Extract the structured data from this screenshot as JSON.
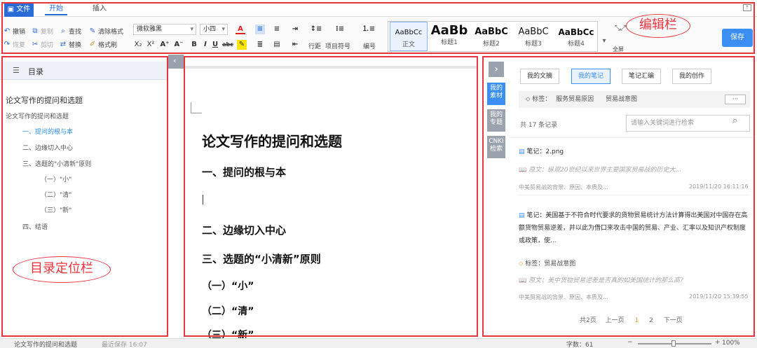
{
  "tabs": {
    "file": "文件",
    "home": "开始",
    "insert": "插入"
  },
  "toolbar": {
    "undo": "撤销",
    "redo": "恢复",
    "copy": "复制",
    "cut": "剪切",
    "find": "查找",
    "replace": "替换",
    "clear_format": "清除格式",
    "format_painter": "格式刷",
    "font_name": "微软雅黑",
    "font_size": "小四",
    "line_spacing": "行距",
    "list_symbol": "项目符号",
    "numbering": "编号",
    "select_all": "全屏",
    "save": "保存"
  },
  "styles": [
    {
      "preview": "AaBbCc",
      "name": "正文"
    },
    {
      "preview": "AaBb",
      "name": "标题1"
    },
    {
      "preview": "AaBbC",
      "name": "标题2"
    },
    {
      "preview": "AaBbC",
      "name": "标题3"
    },
    {
      "preview": "AaBbCc",
      "name": "标题4"
    }
  ],
  "annotations": {
    "editor_bar": "编辑栏",
    "toc_bar": "目录定位栏"
  },
  "toc": {
    "title": "目录",
    "items": [
      "论文写作的提问和选题",
      "论文写作的提问和选题",
      "一、提问的根与本",
      "二、边缘切入中心",
      "三、选题的\"小清新\"原则",
      "（一）\"小\"",
      "（二）\"清\"",
      "（三）\"新\"",
      "四、结语"
    ]
  },
  "editor": {
    "title": "论文写作的提问和选题",
    "lines": [
      "一、提问的根与本",
      "二、边缘切入中心",
      "三、选题的“小清新”原则",
      "（一）“小”",
      "（二）“清”",
      "（三）“新”"
    ]
  },
  "side_tabs": [
    {
      "label": "我的\n素材"
    },
    {
      "label": "我的\n专题"
    },
    {
      "label": "CNKI\n检索"
    }
  ],
  "right": {
    "tabs": [
      "我的文摘",
      "我的笔记",
      "笔记汇编",
      "我的创作"
    ],
    "tags_label": "标签：",
    "tags": [
      "服务贸易原因",
      "贸易战意图"
    ],
    "more": "···",
    "count": "共 17 条记录",
    "search_placeholder": "请输入关键词进行检索",
    "notes": [
      {
        "note": "笔记：2.png",
        "quote": "原文：纵观20世纪以来世界主要国家贸易战的历史大...",
        "source": "中美贸易战的背景、原因、本质及...",
        "time": "2019/11/20 16:11:16"
      },
      {
        "note": "笔记：美国基于不符合时代要求的货物贸易统计方法计算得出美国对中国存在高额货物贸易逆差，并以此为借口来攻击中国的贸易、产业、汇率以及知识产权制度或政策，使...",
        "tag": "标签：贸易战意图",
        "quote": "原文：美中货物贸易逆差是否真的如美国统计的那么高?",
        "source": "中美贸易战的背景、原因、本质及...",
        "time": "2019/11/20 15:39:55"
      }
    ],
    "pagination": {
      "total": "共2页",
      "prev": "上一页",
      "p1": "1",
      "p2": "2",
      "next": "下一页"
    }
  },
  "status": {
    "doc": "论文写作的提问和选题",
    "saved": "最近保存 16:07",
    "words": "字数：61",
    "zoom": "100%"
  },
  "colors": {
    "accent": "#3b8ff2",
    "annotation": "#e8353d"
  }
}
